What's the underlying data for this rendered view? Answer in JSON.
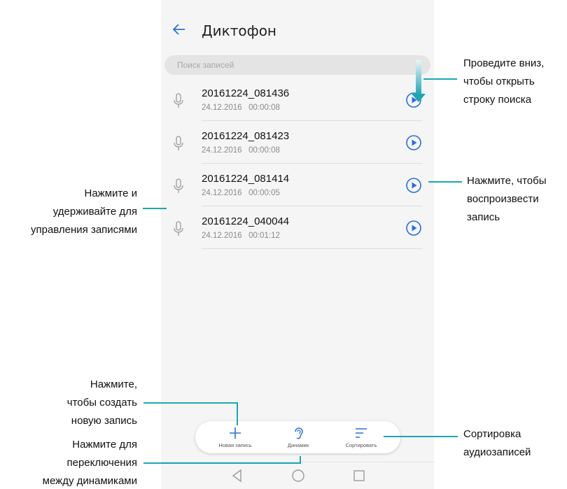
{
  "app": {
    "title": "Диктофон",
    "search_placeholder": "Поиск записей"
  },
  "records": [
    {
      "name": "20161224_081436",
      "date": "24.12.2016",
      "duration": "00:00:08"
    },
    {
      "name": "20161224_081423",
      "date": "24.12.2016",
      "duration": "00:00:08"
    },
    {
      "name": "20161224_081414",
      "date": "24.12.2016",
      "duration": "00:00:05"
    },
    {
      "name": "20161224_040044",
      "date": "24.12.2016",
      "duration": "00:01:12"
    }
  ],
  "toolbar": {
    "new_label": "Новая запись",
    "speaker_label": "Динамик",
    "sort_label": "Сортировать"
  },
  "callouts": {
    "swipe": [
      "Проведите вниз,",
      "чтобы открыть",
      "строку поиска"
    ],
    "play": [
      "Нажмите, чтобы",
      "воспроизвести",
      "запись"
    ],
    "hold": [
      "Нажмите и",
      "удерживайте для",
      "управления записями"
    ],
    "create": [
      "Нажмите,",
      "чтобы создать",
      "новую запись"
    ],
    "speaker": [
      "Нажмите для",
      "переключения",
      "между динамиками"
    ],
    "sort": [
      "Сортировка",
      "аудиозаписей"
    ]
  },
  "colors": {
    "accent": "#1ba6b6",
    "play_icon": "#2b6fd6"
  }
}
